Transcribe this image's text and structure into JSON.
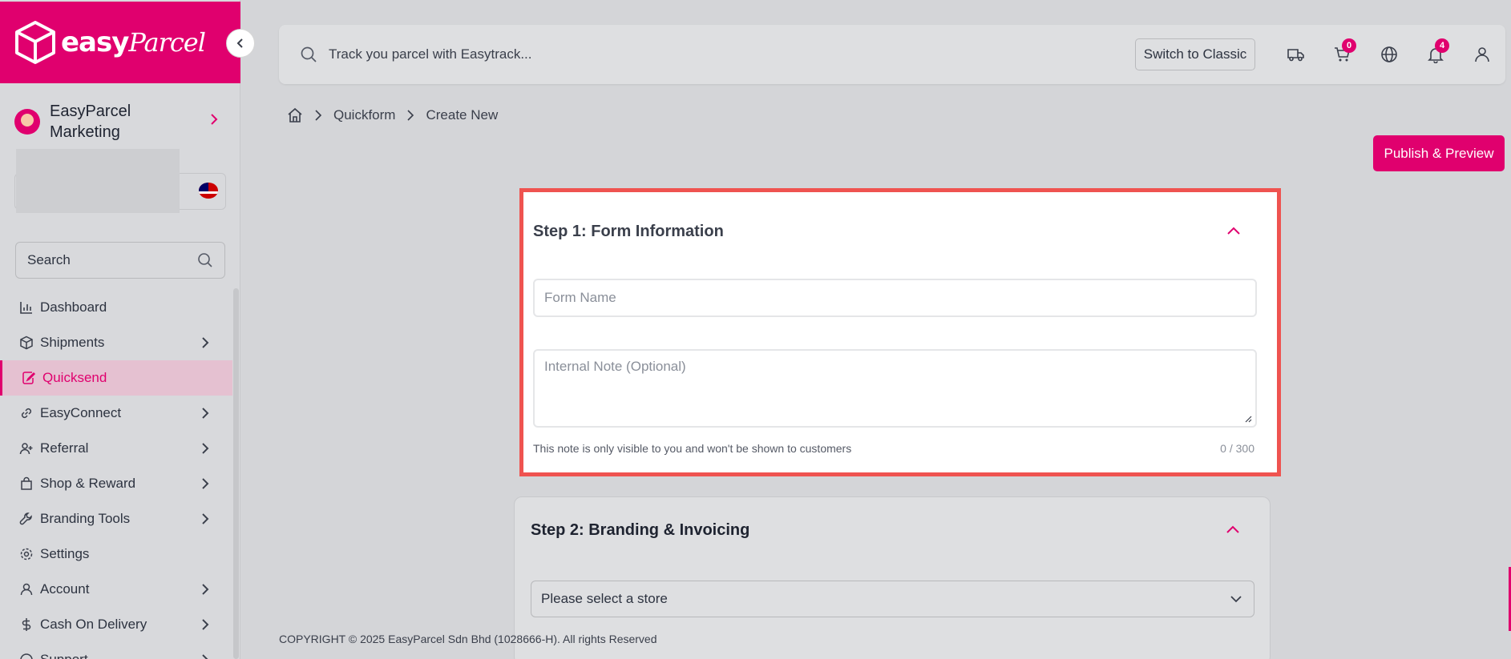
{
  "app": {
    "logo_text": "easy",
    "logo_text_italic": "Parcel",
    "brand_color": "#e0006e"
  },
  "sidebar": {
    "profile_name": "EasyParcel Marketing",
    "search_placeholder": "Search",
    "items": [
      {
        "label": "Dashboard",
        "icon": "chart-icon",
        "has_children": false
      },
      {
        "label": "Shipments",
        "icon": "box-icon",
        "has_children": true
      },
      {
        "label": "Quicksend",
        "icon": "edit-icon",
        "has_children": false,
        "active": true
      },
      {
        "label": "EasyConnect",
        "icon": "link-icon",
        "has_children": true
      },
      {
        "label": "Referral",
        "icon": "user-plus-icon",
        "has_children": true
      },
      {
        "label": "Shop & Reward",
        "icon": "bag-icon",
        "has_children": true
      },
      {
        "label": "Branding Tools",
        "icon": "wrench-icon",
        "has_children": true
      },
      {
        "label": "Settings",
        "icon": "gear-icon",
        "has_children": false
      },
      {
        "label": "Account",
        "icon": "user-icon",
        "has_children": true
      },
      {
        "label": "Cash On Delivery",
        "icon": "dollar-icon",
        "has_children": true
      },
      {
        "label": "Support",
        "icon": "support-icon",
        "has_children": true
      }
    ]
  },
  "topbar": {
    "track_placeholder": "Track you parcel with Easytrack...",
    "switch_label": "Switch to Classic",
    "cart_count": "0",
    "notification_count": "4"
  },
  "breadcrumb": {
    "items": [
      "Quickform",
      "Create New"
    ]
  },
  "actions": {
    "publish_label": "Publish & Preview"
  },
  "step1": {
    "title": "Step 1: Form Information",
    "form_name_placeholder": "Form Name",
    "note_placeholder": "Internal Note (Optional)",
    "note_help": "This note is only visible to you and won't be shown to customers",
    "char_count": "0 / 300"
  },
  "step2": {
    "title": "Step 2: Branding & Invoicing",
    "store_select": "Please select a store"
  },
  "footer": {
    "copyright": "COPYRIGHT © 2025 EasyParcel Sdn Bhd (1028666-H). All rights Reserved"
  }
}
